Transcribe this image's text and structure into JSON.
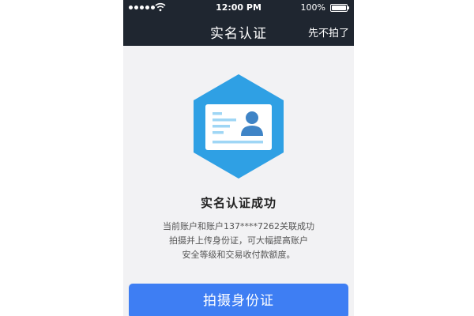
{
  "status_bar": {
    "time": "12:00 PM",
    "battery": "100%",
    "icons": [
      "signal-dots-icon",
      "wifi-icon",
      "battery-icon"
    ]
  },
  "nav": {
    "title": "实名认证",
    "skip_label": "先不拍了"
  },
  "main": {
    "hero_icon": "id-card-hexagon-icon",
    "title": "实名认证成功",
    "description_lines": [
      "当前账户和账户137****7262关联成功",
      "拍摄并上传身份证，可大幅提高账户",
      "安全等级和交易收付款额度。"
    ],
    "button_label": "拍摄身份证"
  },
  "colors": {
    "bar_background": "#1f2630",
    "page_background": "#f2f2f4",
    "accent_blue": "#3e7ef3",
    "hexagon_blue": "#2fa0e4"
  }
}
